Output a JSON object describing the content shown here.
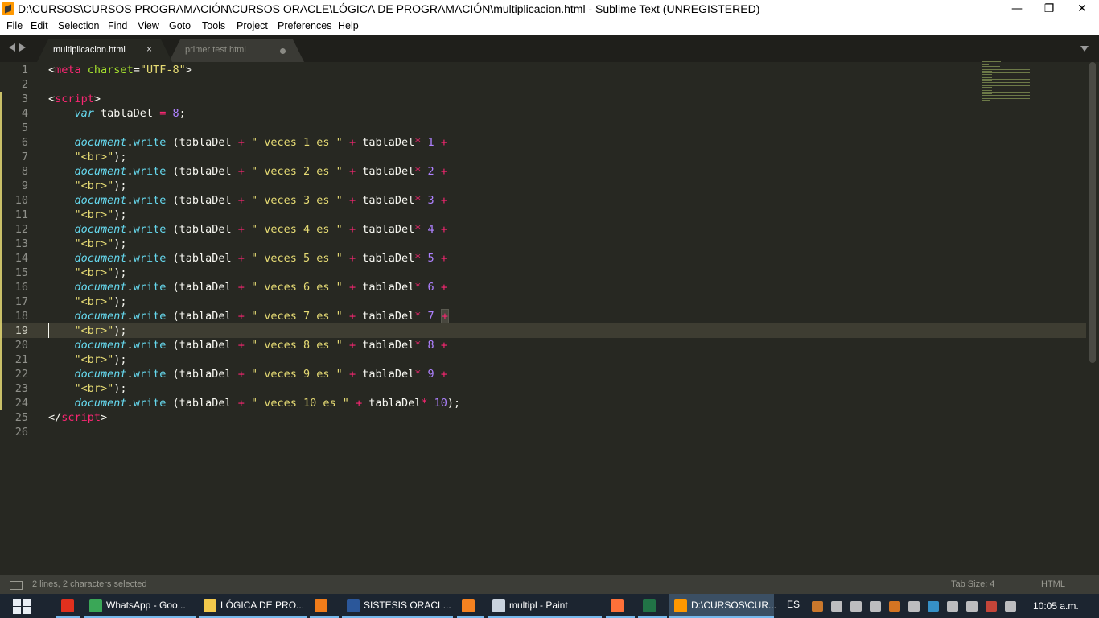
{
  "window": {
    "title": "D:\\CURSOS\\CURSOS PROGRAMACIÓN\\CURSOS ORACLE\\LÓGICA DE PROGRAMACIÓN\\multiplicacion.html - Sublime Text (UNREGISTERED)",
    "minimize_glyph": "—",
    "maximize_glyph": "❐",
    "close_glyph": "✕"
  },
  "menu": [
    "File",
    "Edit",
    "Selection",
    "Find",
    "View",
    "Goto",
    "Tools",
    "Project",
    "Preferences",
    "Help"
  ],
  "tabs": [
    {
      "label": "multiplicacion.html",
      "active": true,
      "close_glyph": "×"
    },
    {
      "label": "primer test.html",
      "active": false,
      "dirty": true
    }
  ],
  "editor": {
    "current_line": 19,
    "lines": [
      {
        "n": "1",
        "code": [
          [
            "t-plain",
            "<"
          ],
          [
            "t-tag",
            "meta"
          ],
          [
            "t-plain",
            " "
          ],
          [
            "t-attr",
            "charset"
          ],
          [
            "t-plain",
            "="
          ],
          [
            "t-str",
            "\"UTF-8\""
          ],
          [
            "t-plain",
            ">"
          ]
        ]
      },
      {
        "n": "2",
        "code": []
      },
      {
        "n": "3",
        "code": [
          [
            "t-plain",
            "<"
          ],
          [
            "t-tag",
            "script"
          ],
          [
            "t-plain",
            ">"
          ]
        ],
        "mod": true
      },
      {
        "n": "4",
        "code": [
          [
            "t-plain",
            "    "
          ],
          [
            "t-kw",
            "var"
          ],
          [
            "t-plain",
            " tablaDel "
          ],
          [
            "t-op",
            "="
          ],
          [
            "t-plain",
            " "
          ],
          [
            "t-num",
            "8"
          ],
          [
            "t-plain",
            ";"
          ]
        ],
        "mod": true
      },
      {
        "n": "5",
        "code": [],
        "mod": true
      },
      {
        "n": "6",
        "code": [
          [
            "t-plain",
            "    "
          ],
          [
            "t-obj",
            "document"
          ],
          [
            "t-plain",
            "."
          ],
          [
            "t-fn",
            "write"
          ],
          [
            "t-plain",
            " (tablaDel "
          ],
          [
            "t-op",
            "+"
          ],
          [
            "t-plain",
            " "
          ],
          [
            "t-str",
            "\" veces 1 es \""
          ],
          [
            "t-plain",
            " "
          ],
          [
            "t-op",
            "+"
          ],
          [
            "t-plain",
            " tablaDel"
          ],
          [
            "t-op",
            "*"
          ],
          [
            "t-plain",
            " "
          ],
          [
            "t-num",
            "1"
          ],
          [
            "t-plain",
            " "
          ],
          [
            "t-op",
            "+"
          ]
        ],
        "mod": true
      },
      {
        "n": "7",
        "code": [
          [
            "t-plain",
            "    "
          ],
          [
            "t-str",
            "\"<br>\""
          ],
          [
            "t-plain",
            ");"
          ]
        ],
        "mod": true
      },
      {
        "n": "8",
        "code": [
          [
            "t-plain",
            "    "
          ],
          [
            "t-obj",
            "document"
          ],
          [
            "t-plain",
            "."
          ],
          [
            "t-fn",
            "write"
          ],
          [
            "t-plain",
            " (tablaDel "
          ],
          [
            "t-op",
            "+"
          ],
          [
            "t-plain",
            " "
          ],
          [
            "t-str",
            "\" veces 2 es \""
          ],
          [
            "t-plain",
            " "
          ],
          [
            "t-op",
            "+"
          ],
          [
            "t-plain",
            " tablaDel"
          ],
          [
            "t-op",
            "*"
          ],
          [
            "t-plain",
            " "
          ],
          [
            "t-num",
            "2"
          ],
          [
            "t-plain",
            " "
          ],
          [
            "t-op",
            "+"
          ]
        ],
        "mod": true
      },
      {
        "n": "9",
        "code": [
          [
            "t-plain",
            "    "
          ],
          [
            "t-str",
            "\"<br>\""
          ],
          [
            "t-plain",
            ");"
          ]
        ],
        "mod": true
      },
      {
        "n": "10",
        "code": [
          [
            "t-plain",
            "    "
          ],
          [
            "t-obj",
            "document"
          ],
          [
            "t-plain",
            "."
          ],
          [
            "t-fn",
            "write"
          ],
          [
            "t-plain",
            " (tablaDel "
          ],
          [
            "t-op",
            "+"
          ],
          [
            "t-plain",
            " "
          ],
          [
            "t-str",
            "\" veces 3 es \""
          ],
          [
            "t-plain",
            " "
          ],
          [
            "t-op",
            "+"
          ],
          [
            "t-plain",
            " tablaDel"
          ],
          [
            "t-op",
            "*"
          ],
          [
            "t-plain",
            " "
          ],
          [
            "t-num",
            "3"
          ],
          [
            "t-plain",
            " "
          ],
          [
            "t-op",
            "+"
          ]
        ],
        "mod": true
      },
      {
        "n": "11",
        "code": [
          [
            "t-plain",
            "    "
          ],
          [
            "t-str",
            "\"<br>\""
          ],
          [
            "t-plain",
            ");"
          ]
        ],
        "mod": true
      },
      {
        "n": "12",
        "code": [
          [
            "t-plain",
            "    "
          ],
          [
            "t-obj",
            "document"
          ],
          [
            "t-plain",
            "."
          ],
          [
            "t-fn",
            "write"
          ],
          [
            "t-plain",
            " (tablaDel "
          ],
          [
            "t-op",
            "+"
          ],
          [
            "t-plain",
            " "
          ],
          [
            "t-str",
            "\" veces 4 es \""
          ],
          [
            "t-plain",
            " "
          ],
          [
            "t-op",
            "+"
          ],
          [
            "t-plain",
            " tablaDel"
          ],
          [
            "t-op",
            "*"
          ],
          [
            "t-plain",
            " "
          ],
          [
            "t-num",
            "4"
          ],
          [
            "t-plain",
            " "
          ],
          [
            "t-op",
            "+"
          ]
        ],
        "mod": true
      },
      {
        "n": "13",
        "code": [
          [
            "t-plain",
            "    "
          ],
          [
            "t-str",
            "\"<br>\""
          ],
          [
            "t-plain",
            ");"
          ]
        ],
        "mod": true
      },
      {
        "n": "14",
        "code": [
          [
            "t-plain",
            "    "
          ],
          [
            "t-obj",
            "document"
          ],
          [
            "t-plain",
            "."
          ],
          [
            "t-fn",
            "write"
          ],
          [
            "t-plain",
            " (tablaDel "
          ],
          [
            "t-op",
            "+"
          ],
          [
            "t-plain",
            " "
          ],
          [
            "t-str",
            "\" veces 5 es \""
          ],
          [
            "t-plain",
            " "
          ],
          [
            "t-op",
            "+"
          ],
          [
            "t-plain",
            " tablaDel"
          ],
          [
            "t-op",
            "*"
          ],
          [
            "t-plain",
            " "
          ],
          [
            "t-num",
            "5"
          ],
          [
            "t-plain",
            " "
          ],
          [
            "t-op",
            "+"
          ]
        ],
        "mod": true
      },
      {
        "n": "15",
        "code": [
          [
            "t-plain",
            "    "
          ],
          [
            "t-str",
            "\"<br>\""
          ],
          [
            "t-plain",
            ");"
          ]
        ],
        "mod": true
      },
      {
        "n": "16",
        "code": [
          [
            "t-plain",
            "    "
          ],
          [
            "t-obj",
            "document"
          ],
          [
            "t-plain",
            "."
          ],
          [
            "t-fn",
            "write"
          ],
          [
            "t-plain",
            " (tablaDel "
          ],
          [
            "t-op",
            "+"
          ],
          [
            "t-plain",
            " "
          ],
          [
            "t-str",
            "\" veces 6 es \""
          ],
          [
            "t-plain",
            " "
          ],
          [
            "t-op",
            "+"
          ],
          [
            "t-plain",
            " tablaDel"
          ],
          [
            "t-op",
            "*"
          ],
          [
            "t-plain",
            " "
          ],
          [
            "t-num",
            "6"
          ],
          [
            "t-plain",
            " "
          ],
          [
            "t-op",
            "+"
          ]
        ],
        "mod": true
      },
      {
        "n": "17",
        "code": [
          [
            "t-plain",
            "    "
          ],
          [
            "t-str",
            "\"<br>\""
          ],
          [
            "t-plain",
            ");"
          ]
        ],
        "mod": true
      },
      {
        "n": "18",
        "code": [
          [
            "t-plain",
            "    "
          ],
          [
            "t-obj",
            "document"
          ],
          [
            "t-plain",
            "."
          ],
          [
            "t-fn",
            "write"
          ],
          [
            "t-plain",
            " (tablaDel "
          ],
          [
            "t-op",
            "+"
          ],
          [
            "t-plain",
            " "
          ],
          [
            "t-str",
            "\" veces 7 es \""
          ],
          [
            "t-plain",
            " "
          ],
          [
            "t-op",
            "+"
          ],
          [
            "t-plain",
            " tablaDel"
          ],
          [
            "t-op",
            "*"
          ],
          [
            "t-plain",
            " "
          ],
          [
            "t-num",
            "7"
          ],
          [
            "t-plain",
            " "
          ],
          [
            "t-op sel-mark",
            "+"
          ]
        ],
        "mod": true
      },
      {
        "n": "19",
        "code": [
          [
            "t-plain",
            "    "
          ],
          [
            "t-str",
            "\"<br>\""
          ],
          [
            "t-plain",
            ");"
          ]
        ],
        "mod": true
      },
      {
        "n": "20",
        "code": [
          [
            "t-plain",
            "    "
          ],
          [
            "t-obj",
            "document"
          ],
          [
            "t-plain",
            "."
          ],
          [
            "t-fn",
            "write"
          ],
          [
            "t-plain",
            " (tablaDel "
          ],
          [
            "t-op",
            "+"
          ],
          [
            "t-plain",
            " "
          ],
          [
            "t-str",
            "\" veces 8 es \""
          ],
          [
            "t-plain",
            " "
          ],
          [
            "t-op",
            "+"
          ],
          [
            "t-plain",
            " tablaDel"
          ],
          [
            "t-op",
            "*"
          ],
          [
            "t-plain",
            " "
          ],
          [
            "t-num",
            "8"
          ],
          [
            "t-plain",
            " "
          ],
          [
            "t-op",
            "+"
          ]
        ],
        "mod": true
      },
      {
        "n": "21",
        "code": [
          [
            "t-plain",
            "    "
          ],
          [
            "t-str",
            "\"<br>\""
          ],
          [
            "t-plain",
            ");"
          ]
        ],
        "mod": true
      },
      {
        "n": "22",
        "code": [
          [
            "t-plain",
            "    "
          ],
          [
            "t-obj",
            "document"
          ],
          [
            "t-plain",
            "."
          ],
          [
            "t-fn",
            "write"
          ],
          [
            "t-plain",
            " (tablaDel "
          ],
          [
            "t-op",
            "+"
          ],
          [
            "t-plain",
            " "
          ],
          [
            "t-str",
            "\" veces 9 es \""
          ],
          [
            "t-plain",
            " "
          ],
          [
            "t-op",
            "+"
          ],
          [
            "t-plain",
            " tablaDel"
          ],
          [
            "t-op",
            "*"
          ],
          [
            "t-plain",
            " "
          ],
          [
            "t-num",
            "9"
          ],
          [
            "t-plain",
            " "
          ],
          [
            "t-op",
            "+"
          ]
        ],
        "mod": true
      },
      {
        "n": "23",
        "code": [
          [
            "t-plain",
            "    "
          ],
          [
            "t-str",
            "\"<br>\""
          ],
          [
            "t-plain",
            ");"
          ]
        ],
        "mod": true
      },
      {
        "n": "24",
        "code": [
          [
            "t-plain",
            "    "
          ],
          [
            "t-obj",
            "document"
          ],
          [
            "t-plain",
            "."
          ],
          [
            "t-fn",
            "write"
          ],
          [
            "t-plain",
            " (tablaDel "
          ],
          [
            "t-op",
            "+"
          ],
          [
            "t-plain",
            " "
          ],
          [
            "t-str",
            "\" veces 10 es \""
          ],
          [
            "t-plain",
            " "
          ],
          [
            "t-op",
            "+"
          ],
          [
            "t-plain",
            " tablaDel"
          ],
          [
            "t-op",
            "*"
          ],
          [
            "t-plain",
            " "
          ],
          [
            "t-num",
            "10"
          ],
          [
            "t-plain",
            ");"
          ]
        ],
        "mod": true
      },
      {
        "n": "25",
        "code": [
          [
            "t-plain",
            "</"
          ],
          [
            "t-tag",
            "script"
          ],
          [
            "t-plain",
            ">"
          ]
        ]
      },
      {
        "n": "26",
        "code": []
      }
    ]
  },
  "statusbar": {
    "selection": "2 lines, 2 characters selected",
    "tab_size": "Tab Size: 4",
    "syntax": "HTML"
  },
  "taskbar": {
    "items": [
      {
        "label": "",
        "icon": "acrobat-icon",
        "color": "#e0301e"
      },
      {
        "label": "WhatsApp - Goo...",
        "icon": "chrome-icon",
        "color": "#3aa757"
      },
      {
        "label": "LÓGICA DE PRO...",
        "icon": "folder-icon",
        "color": "#f2c94c"
      },
      {
        "label": "",
        "icon": "media-player-icon",
        "color": "#f07c1a"
      },
      {
        "label": "SISTESIS ORACL...",
        "icon": "word-icon",
        "color": "#2b579a"
      },
      {
        "label": "",
        "icon": "chart-app-icon",
        "color": "#f58220"
      },
      {
        "label": "multipl - Paint",
        "icon": "paint-icon",
        "color": "#c9d3de"
      },
      {
        "label": "",
        "icon": "firefox-icon",
        "color": "#ff7139"
      },
      {
        "label": "",
        "icon": "excel-icon",
        "color": "#217346"
      },
      {
        "label": "D:\\CURSOS\\CUR...",
        "icon": "sublime-icon",
        "color": "#ff9800",
        "active": true
      }
    ],
    "language": "ES",
    "clock": "10:05 a.m."
  }
}
